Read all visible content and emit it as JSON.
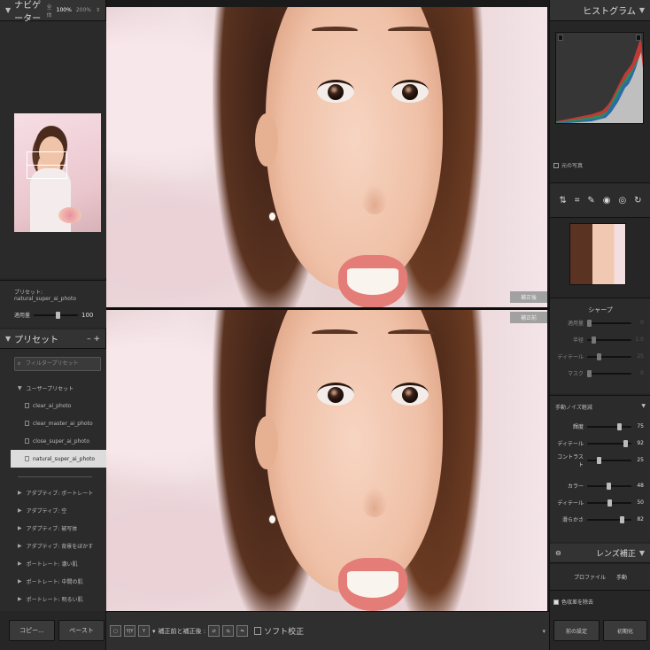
{
  "navigator": {
    "title": "ナビゲーター",
    "fit_label": "全体",
    "zoom_active": "100%",
    "zoom_other": "200%"
  },
  "preset_info": {
    "preset_label": "プリセット: natural_super_ai_photo",
    "amount_label": "適用量",
    "amount_value": "100",
    "amount_level": 1.0
  },
  "presets": {
    "title": "プリセット",
    "header_controls": "– +",
    "search_placeholder": "フィルタープリセット",
    "user_group": "ユーザープリセット",
    "user_items": [
      "clear_ai_photo",
      "clear_master_ai_photo",
      "close_super_ai_photo",
      "natural_super_ai_photo"
    ],
    "selected_index": 3,
    "groups": [
      "アダプティブ: ポートレート",
      "アダプティブ: 空",
      "アダプティブ: 被写体",
      "アダプティブ: 背景をぼかす",
      "ポートレート: 濃い肌",
      "ポートレート: 中間の肌",
      "ポートレート: 明るい肌"
    ]
  },
  "left_buttons": {
    "copy": "コピー...",
    "paste": "ペースト"
  },
  "center": {
    "tag_after": "補正後",
    "tag_before": "補正前"
  },
  "toolbar": {
    "btn1": "▢",
    "btn2": "Y|Y",
    "btn3": "Y|Y",
    "swap_label": "補正前と補正後 :",
    "soft_proof_label": "ソフト校正",
    "dropdown": "▾"
  },
  "histogram": {
    "title": "ヒストグラム",
    "checkbox_label": "元の写真"
  },
  "sharpen": {
    "title": "シャープ",
    "rows": [
      {
        "label": "適用量",
        "value": "0",
        "level": 0.0
      },
      {
        "label": "半径",
        "value": "1.0",
        "level": 0.1
      },
      {
        "label": "ディテール",
        "value": "25",
        "level": 0.25
      },
      {
        "label": "マスク",
        "value": "0",
        "level": 0.0
      }
    ]
  },
  "noise": {
    "title": "手動ノイズ軽減",
    "luminance_rows": [
      {
        "label": "輝度",
        "value": "75",
        "level": 0.75
      },
      {
        "label": "ディテール",
        "value": "92",
        "level": 0.92
      },
      {
        "label": "コントラスト",
        "value": "25",
        "level": 0.25
      }
    ],
    "color_rows": [
      {
        "label": "カラー",
        "value": "48",
        "level": 0.48
      },
      {
        "label": "ディテール",
        "value": "50",
        "level": 0.5
      },
      {
        "label": "滑らかさ",
        "value": "82",
        "level": 0.82
      }
    ]
  },
  "lens": {
    "title": "レンズ補正",
    "tab_profile": "プロファイル",
    "tab_manual": "手動",
    "chk_label": "色収差を除去"
  },
  "right_buttons": {
    "previous": "前の設定",
    "reset": "初期化"
  }
}
